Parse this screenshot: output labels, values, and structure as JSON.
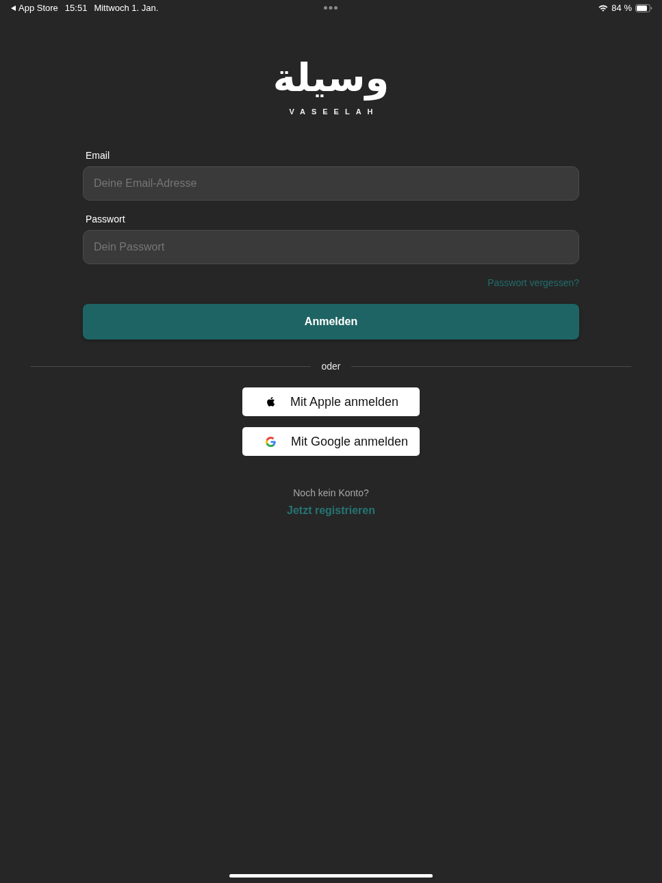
{
  "status_bar": {
    "back_label": "App Store",
    "time": "15:51",
    "date": "Mittwoch 1. Jan.",
    "battery_percent": "84 %"
  },
  "logo": {
    "arabic": "وسيلة",
    "latin": "VASEELAH"
  },
  "form": {
    "fields": [
      {
        "label": "Email",
        "placeholder": "Deine Email-Adresse"
      },
      {
        "label": "Passwort",
        "placeholder": "Dein Passwort"
      }
    ],
    "forgot_link": "Passwort vergessen?",
    "submit_button": "Anmelden"
  },
  "divider": {
    "label": "oder"
  },
  "social_buttons": [
    {
      "kind": "apple",
      "label": "Mit Apple anmelden"
    },
    {
      "kind": "google",
      "label": "Mit Google anmelden"
    }
  ],
  "signup": {
    "prompt": "Noch kein Konto?",
    "link": "Jetzt registrieren"
  }
}
